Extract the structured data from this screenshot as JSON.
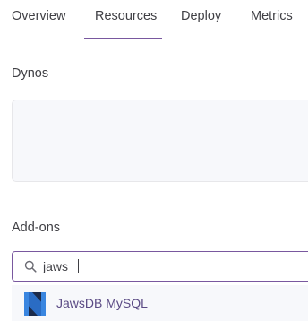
{
  "nav": {
    "tabs": [
      {
        "label": "Overview"
      },
      {
        "label": "Resources"
      },
      {
        "label": "Deploy"
      },
      {
        "label": "Metrics"
      }
    ],
    "active_tab": "Resources"
  },
  "dynos": {
    "title": "Dynos"
  },
  "addons": {
    "title": "Add-ons",
    "search": {
      "value": "jaws",
      "icon": "search-icon"
    },
    "results": [
      {
        "label": "JawsDB MySQL",
        "icon": "jawsdb-logo-icon"
      }
    ]
  },
  "colors": {
    "accent": "#79589f",
    "text": "#3f3f44",
    "result_text": "#5a4a84",
    "logo_blue": "#2a6cc4",
    "logo_dark": "#1b2a4a"
  }
}
